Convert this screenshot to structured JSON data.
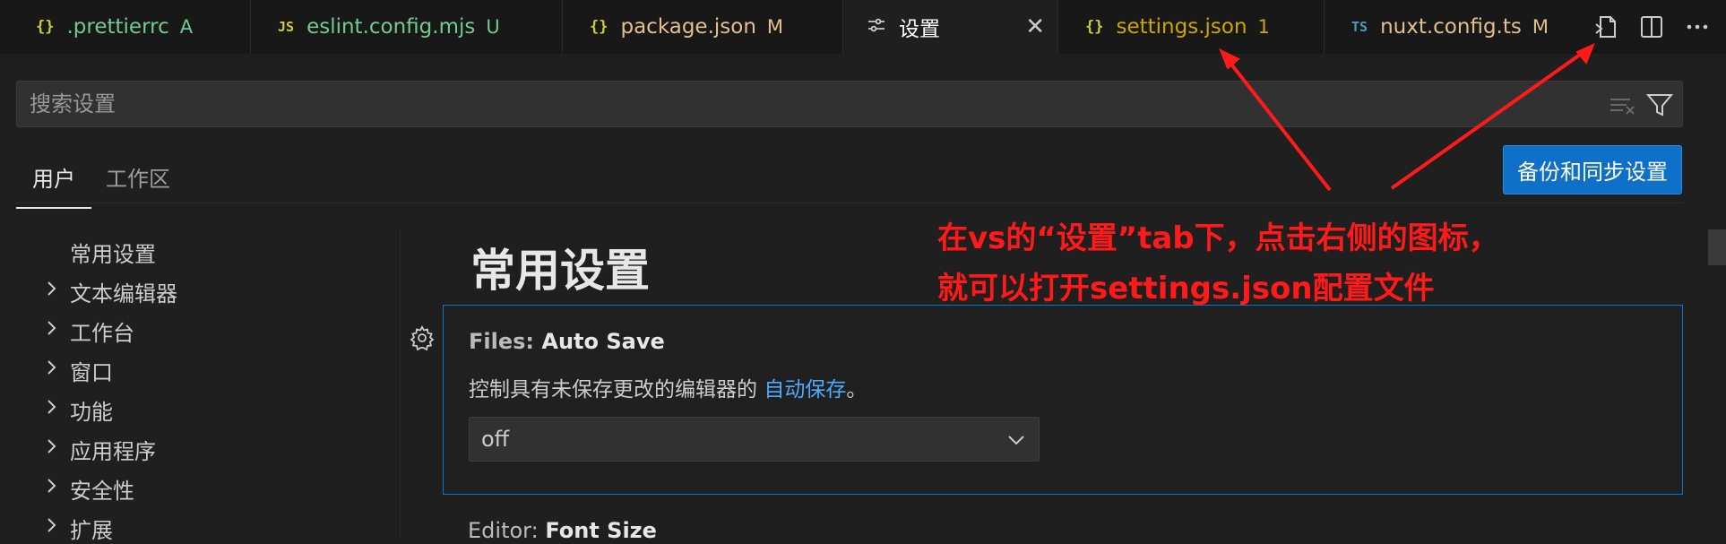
{
  "tabs": [
    {
      "icon": "{}",
      "label": ".prettierrc",
      "badge": "A",
      "label_color": "#73c991",
      "badge_color": "#73c991"
    },
    {
      "icon": "JS",
      "label": "eslint.config.mjs",
      "badge": "U",
      "label_color": "#73c991",
      "badge_color": "#73c991"
    },
    {
      "icon": "{}",
      "label": "package.json",
      "badge": "M",
      "label_color": "#e2c08d",
      "badge_color": "#e2c08d"
    },
    {
      "icon": "≡",
      "label": "设置",
      "badge": "",
      "label_color": "#ffffff",
      "badge_color": "#ffffff"
    },
    {
      "icon": "{}",
      "label": "settings.json",
      "badge": "1",
      "label_color": "#cca700",
      "badge_color": "#cca700"
    },
    {
      "icon": "TS",
      "label": "nuxt.config.ts",
      "badge": "M",
      "label_color": "#e2c08d",
      "badge_color": "#e2c08d"
    }
  ],
  "active_tab_close": "✕",
  "tab_actions": [
    "open-settings-json-icon",
    "split-editor-icon",
    "more-actions-icon"
  ],
  "search": {
    "placeholder": "搜索设置"
  },
  "scope_tabs": [
    "用户",
    "工作区"
  ],
  "sync_button": "备份和同步设置",
  "toc": [
    {
      "label": "常用设置",
      "expandable": false
    },
    {
      "label": "文本编辑器",
      "expandable": true
    },
    {
      "label": "工作台",
      "expandable": true
    },
    {
      "label": "窗口",
      "expandable": true
    },
    {
      "label": "功能",
      "expandable": true
    },
    {
      "label": "应用程序",
      "expandable": true
    },
    {
      "label": "安全性",
      "expandable": true
    },
    {
      "label": "扩展",
      "expandable": true
    }
  ],
  "section_title": "常用设置",
  "setting": {
    "category": "Files: ",
    "name": "Auto Save",
    "description": "控制具有未保存更改的编辑器的 ",
    "description_link": "自动保存",
    "description_end": "。",
    "value": "off"
  },
  "next_setting": {
    "category": "Editor: ",
    "name": "Font Size"
  },
  "annotation": {
    "line1": "在vs的“设置”tab下，点击右侧的图标，",
    "line2": "就可以打开settings.json配置文件",
    "color": "#ff1a1a"
  },
  "colors": {
    "accent": "#0078d4",
    "button": "#0e70c8",
    "link": "#4daafc"
  }
}
